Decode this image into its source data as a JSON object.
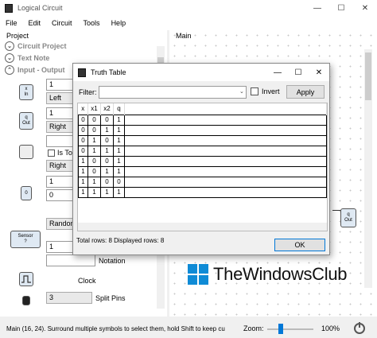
{
  "window": {
    "title": "Logical Circuit",
    "minimize": "—",
    "maximize": "☐",
    "close": "✕"
  },
  "menu": [
    "File",
    "Edit",
    "Circuit",
    "Tools",
    "Help"
  ],
  "project": {
    "label": "Project",
    "sections": [
      "Circuit Project",
      "Text Note",
      "Input - Output"
    ],
    "input": {
      "symbol_line1": "x",
      "symbol_line2": "In",
      "count": "1",
      "side": "Left"
    },
    "output": {
      "symbol_line1": "q",
      "symbol_line2": "Out",
      "count": "1",
      "side": "Right"
    },
    "toggle": {
      "text": "",
      "checkbox_label": "Is Tog",
      "side": "Right"
    },
    "constant": {
      "symbol": "0",
      "count": "1",
      "value": "0",
      "side": "Random"
    },
    "sensor": {
      "symbol_line1": "Sensor",
      "symbol_line2": "?",
      "count": "1",
      "side": "Right",
      "notation_label": "Notation"
    },
    "clock": {
      "label": "Clock"
    },
    "split": {
      "count": "3",
      "label": "Split Pins"
    }
  },
  "main": {
    "label": "Main",
    "out_symbol_line1": "q",
    "out_symbol_line2": "Out"
  },
  "status": {
    "text": "Main (16, 24). Surround multiple symbols to select them, hold Shift to keep cu",
    "zoom_label": "Zoom:",
    "zoom_value": "100%",
    "zoom_fraction": 0.3
  },
  "dialog": {
    "title": "Truth Table",
    "filter_label": "Filter:",
    "filter_value": "",
    "invert_label": "Invert",
    "apply_label": "Apply",
    "columns": [
      "x",
      "x1",
      "x2",
      "q"
    ],
    "rows": [
      [
        "0",
        "0",
        "0",
        "1"
      ],
      [
        "0",
        "0",
        "1",
        "1"
      ],
      [
        "0",
        "1",
        "0",
        "1"
      ],
      [
        "0",
        "1",
        "1",
        "1"
      ],
      [
        "1",
        "0",
        "0",
        "1"
      ],
      [
        "1",
        "0",
        "1",
        "1"
      ],
      [
        "1",
        "1",
        "0",
        "0"
      ],
      [
        "1",
        "1",
        "1",
        "1"
      ]
    ],
    "total_text": "Total rows: 8   Displayed rows: 8",
    "ok_label": "OK",
    "minimize": "—",
    "maximize": "☐",
    "close": "✕"
  },
  "watermark": {
    "text": "TheWindowsClub"
  }
}
